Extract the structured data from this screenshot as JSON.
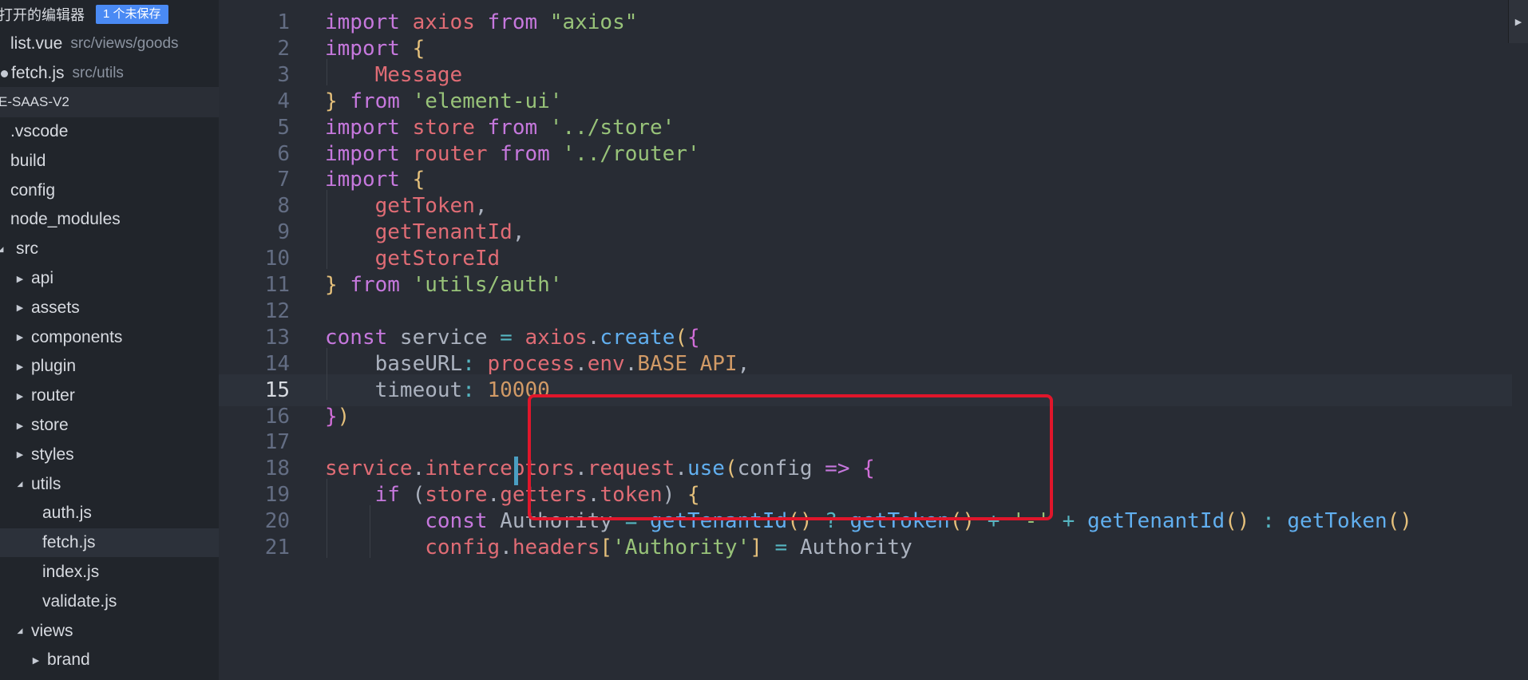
{
  "sidebar": {
    "open_editors_header": "打开的编辑器",
    "unsaved_badge": "1 个未保存",
    "open_editors": [
      {
        "name": "list.vue",
        "path": "src/views/goods",
        "dirty": false
      },
      {
        "name": "fetch.js",
        "path": "src/utils",
        "dirty": true
      }
    ],
    "project_name": "E-SAAS-V2",
    "tree": [
      {
        "label": ".vscode",
        "depth": 0,
        "arrow": ""
      },
      {
        "label": "build",
        "depth": 0,
        "arrow": ""
      },
      {
        "label": "config",
        "depth": 0,
        "arrow": ""
      },
      {
        "label": "node_modules",
        "depth": 0,
        "arrow": ""
      },
      {
        "label": "src",
        "depth": 0,
        "arrow": "expanded"
      },
      {
        "label": "api",
        "depth": 1,
        "arrow": "collapsed"
      },
      {
        "label": "assets",
        "depth": 1,
        "arrow": "collapsed"
      },
      {
        "label": "components",
        "depth": 1,
        "arrow": "collapsed"
      },
      {
        "label": "plugin",
        "depth": 1,
        "arrow": "collapsed"
      },
      {
        "label": "router",
        "depth": 1,
        "arrow": "collapsed"
      },
      {
        "label": "store",
        "depth": 1,
        "arrow": "collapsed"
      },
      {
        "label": "styles",
        "depth": 1,
        "arrow": "collapsed"
      },
      {
        "label": "utils",
        "depth": 1,
        "arrow": "expanded"
      },
      {
        "label": "auth.js",
        "depth": 2,
        "arrow": ""
      },
      {
        "label": "fetch.js",
        "depth": 2,
        "arrow": "",
        "selected": true
      },
      {
        "label": "index.js",
        "depth": 2,
        "arrow": ""
      },
      {
        "label": "validate.js",
        "depth": 2,
        "arrow": ""
      },
      {
        "label": "views",
        "depth": 1,
        "arrow": "expanded"
      },
      {
        "label": "brand",
        "depth": 2,
        "arrow": "collapsed"
      }
    ]
  },
  "editor": {
    "current_line": 15,
    "lines": [
      {
        "n": "1",
        "tokens": [
          [
            "keyword",
            "import"
          ],
          [
            "plain",
            " "
          ],
          [
            "variable",
            "axios"
          ],
          [
            "plain",
            " "
          ],
          [
            "keyword",
            "from"
          ],
          [
            "plain",
            " "
          ],
          [
            "string",
            "\"axios\""
          ]
        ]
      },
      {
        "n": "2",
        "tokens": [
          [
            "keyword",
            "import"
          ],
          [
            "plain",
            " "
          ],
          [
            "brace",
            "{"
          ]
        ]
      },
      {
        "n": "3",
        "tokens": [
          [
            "plain",
            "    "
          ],
          [
            "variable",
            "Message"
          ]
        ]
      },
      {
        "n": "4",
        "tokens": [
          [
            "brace",
            "}"
          ],
          [
            "plain",
            " "
          ],
          [
            "keyword",
            "from"
          ],
          [
            "plain",
            " "
          ],
          [
            "string",
            "'element-ui'"
          ]
        ]
      },
      {
        "n": "5",
        "tokens": [
          [
            "keyword",
            "import"
          ],
          [
            "plain",
            " "
          ],
          [
            "variable",
            "store"
          ],
          [
            "plain",
            " "
          ],
          [
            "keyword",
            "from"
          ],
          [
            "plain",
            " "
          ],
          [
            "string",
            "'../store'"
          ]
        ]
      },
      {
        "n": "6",
        "tokens": [
          [
            "keyword",
            "import"
          ],
          [
            "plain",
            " "
          ],
          [
            "variable",
            "router"
          ],
          [
            "plain",
            " "
          ],
          [
            "keyword",
            "from"
          ],
          [
            "plain",
            " "
          ],
          [
            "string",
            "'../router'"
          ]
        ]
      },
      {
        "n": "7",
        "tokens": [
          [
            "keyword",
            "import"
          ],
          [
            "plain",
            " "
          ],
          [
            "brace",
            "{"
          ]
        ]
      },
      {
        "n": "8",
        "tokens": [
          [
            "plain",
            "    "
          ],
          [
            "variable",
            "getToken"
          ],
          [
            "punct",
            ","
          ]
        ]
      },
      {
        "n": "9",
        "tokens": [
          [
            "plain",
            "    "
          ],
          [
            "variable",
            "getTenantId"
          ],
          [
            "punct",
            ","
          ]
        ]
      },
      {
        "n": "10",
        "tokens": [
          [
            "plain",
            "    "
          ],
          [
            "variable",
            "getStoreId"
          ]
        ]
      },
      {
        "n": "11",
        "tokens": [
          [
            "brace",
            "}"
          ],
          [
            "plain",
            " "
          ],
          [
            "keyword",
            "from"
          ],
          [
            "plain",
            " "
          ],
          [
            "string",
            "'utils/auth'"
          ]
        ]
      },
      {
        "n": "12",
        "tokens": []
      },
      {
        "n": "13",
        "tokens": [
          [
            "keyword",
            "const"
          ],
          [
            "plain",
            " service "
          ],
          [
            "operator",
            "="
          ],
          [
            "plain",
            " "
          ],
          [
            "variable",
            "axios"
          ],
          [
            "punct",
            "."
          ],
          [
            "function",
            "create"
          ],
          [
            "paren",
            "("
          ],
          [
            "brace2",
            "{"
          ]
        ]
      },
      {
        "n": "14",
        "tokens": [
          [
            "plain",
            "    baseURL"
          ],
          [
            "operator",
            ":"
          ],
          [
            "plain",
            " "
          ],
          [
            "variable",
            "process"
          ],
          [
            "punct",
            "."
          ],
          [
            "property",
            "env"
          ],
          [
            "punct",
            "."
          ],
          [
            "constant",
            "BASE_API"
          ],
          [
            "punct",
            ","
          ]
        ]
      },
      {
        "n": "15",
        "tokens": [
          [
            "plain",
            "    timeout"
          ],
          [
            "operator",
            ":"
          ],
          [
            "plain",
            " "
          ],
          [
            "number",
            "10000"
          ]
        ]
      },
      {
        "n": "16",
        "tokens": [
          [
            "brace2",
            "}"
          ],
          [
            "paren",
            ")"
          ]
        ]
      },
      {
        "n": "17",
        "tokens": []
      },
      {
        "n": "18",
        "tokens": [
          [
            "variable",
            "service"
          ],
          [
            "punct",
            "."
          ],
          [
            "property",
            "interceptors"
          ],
          [
            "punct",
            "."
          ],
          [
            "property",
            "request"
          ],
          [
            "punct",
            "."
          ],
          [
            "function",
            "use"
          ],
          [
            "paren",
            "("
          ],
          [
            "plain",
            "config "
          ],
          [
            "keyword",
            "=>"
          ],
          [
            "plain",
            " "
          ],
          [
            "brace2",
            "{"
          ]
        ]
      },
      {
        "n": "19",
        "tokens": [
          [
            "plain",
            "    "
          ],
          [
            "keyword",
            "if"
          ],
          [
            "plain",
            " ("
          ],
          [
            "variable",
            "store"
          ],
          [
            "punct",
            "."
          ],
          [
            "property",
            "getters"
          ],
          [
            "punct",
            "."
          ],
          [
            "property",
            "token"
          ],
          [
            "plain",
            ") "
          ],
          [
            "brace",
            "{"
          ]
        ]
      },
      {
        "n": "20",
        "tokens": [
          [
            "plain",
            "        "
          ],
          [
            "keyword",
            "const"
          ],
          [
            "plain",
            " Authority "
          ],
          [
            "operator",
            "="
          ],
          [
            "plain",
            " "
          ],
          [
            "function",
            "getTenantId"
          ],
          [
            "paren",
            "()"
          ],
          [
            "plain",
            " "
          ],
          [
            "operator",
            "?"
          ],
          [
            "plain",
            " "
          ],
          [
            "function",
            "getToken"
          ],
          [
            "paren",
            "()"
          ],
          [
            "plain",
            " "
          ],
          [
            "operator",
            "+"
          ],
          [
            "plain",
            " "
          ],
          [
            "string",
            "'-'"
          ],
          [
            "plain",
            " "
          ],
          [
            "operator",
            "+"
          ],
          [
            "plain",
            " "
          ],
          [
            "function",
            "getTenantId"
          ],
          [
            "paren",
            "()"
          ],
          [
            "plain",
            " "
          ],
          [
            "operator",
            ":"
          ],
          [
            "plain",
            " "
          ],
          [
            "function",
            "getToken"
          ],
          [
            "paren",
            "()"
          ]
        ]
      },
      {
        "n": "21",
        "tokens": [
          [
            "plain",
            "        "
          ],
          [
            "variable",
            "config"
          ],
          [
            "punct",
            "."
          ],
          [
            "property",
            "headers"
          ],
          [
            "paren",
            "["
          ],
          [
            "string",
            "'Authority'"
          ],
          [
            "paren",
            "]"
          ],
          [
            "plain",
            " "
          ],
          [
            "operator",
            "="
          ],
          [
            "plain",
            " Authority"
          ]
        ]
      }
    ]
  }
}
